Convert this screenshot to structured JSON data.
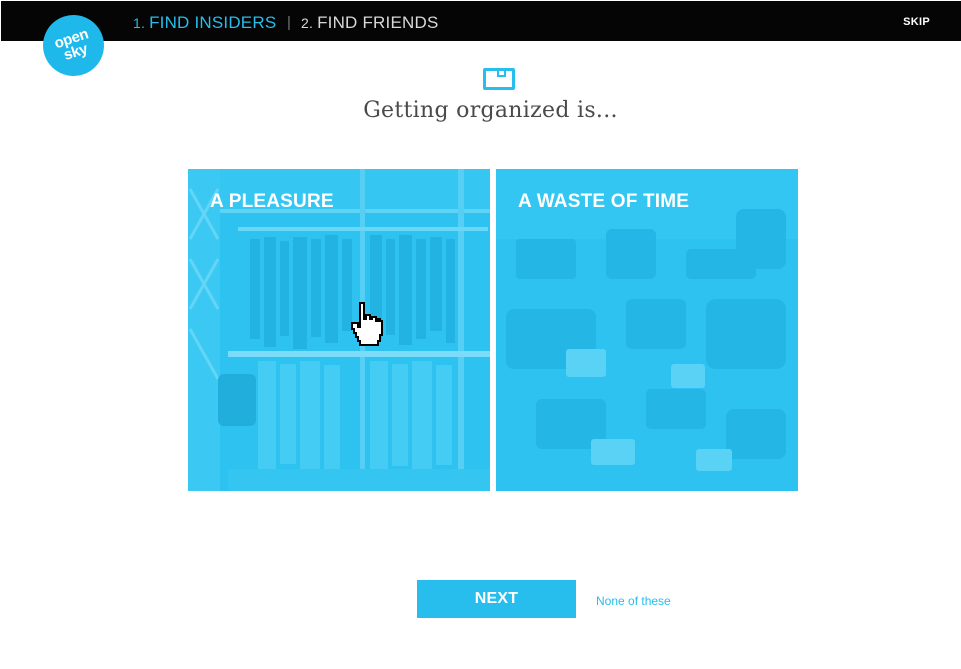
{
  "nav": {
    "step1_number": "1.",
    "step1_label": "FIND INSIDERS",
    "separator": "|",
    "step2_number": "2.",
    "step2_label": "FIND FRIENDS",
    "skip_label": "SKIP"
  },
  "logo": {
    "line1": "open",
    "line2": "sky"
  },
  "question": {
    "icon": "box-icon",
    "text": "Getting organized is..."
  },
  "choices": [
    {
      "label": "A PLEASURE",
      "image": "organized-closet"
    },
    {
      "label": "A WASTE OF TIME",
      "image": "cluttered-room"
    }
  ],
  "footer": {
    "next_label": "NEXT",
    "none_label": "None of these"
  },
  "colors": {
    "accent": "#27bdec",
    "topbar": "#050505",
    "text": "#4a4a4a"
  },
  "cursor": "hand-pointer-icon"
}
